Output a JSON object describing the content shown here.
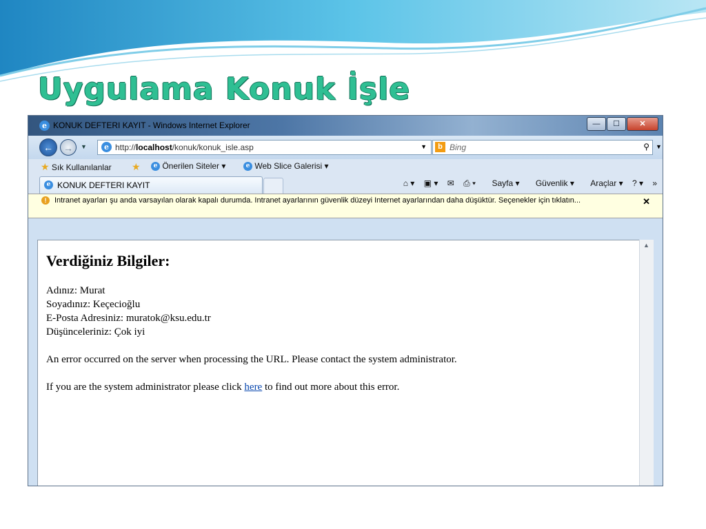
{
  "slide": {
    "title": "Uygulama Konuk İşle"
  },
  "window": {
    "title": "KONUK DEFTERI KAYIT - Windows Internet Explorer",
    "buttons": {
      "minimize": "—",
      "maximize": "☐",
      "close": "✕"
    }
  },
  "navbar": {
    "address_prefix": "http://",
    "address_host": "localhost",
    "address_path": "/konuk/konuk_isle.asp",
    "search_placeholder": "Bing"
  },
  "favorites": {
    "favorites_label": "Sık Kullanılanlar",
    "suggested_sites": "Önerilen Siteler",
    "web_slice": "Web Slice Galerisi"
  },
  "tabs": {
    "active_tab": "KONUK DEFTERI KAYIT"
  },
  "command_bar": {
    "page": "Sayfa",
    "safety": "Güvenlik",
    "tools": "Araçlar"
  },
  "infobar": {
    "text": "Intranet ayarları şu anda varsayılan olarak kapalı durumda. Intranet ayarlarının güvenlik düzeyi Internet ayarlarından daha düşüktür. Seçenekler için tıklatın..."
  },
  "content": {
    "heading": "Verdiğiniz Bilgiler:",
    "name_line": "Adınız: Murat",
    "surname_line": "Soyadınız: Keçecioğlu",
    "email_line": "E-Posta Adresiniz: muratok@ksu.edu.tr",
    "thoughts_line": "Düşünceleriniz: Çok iyi",
    "error_line": "An error occurred on the server when processing the URL. Please contact the system administrator.",
    "admin_before": "If you are the system administrator please click ",
    "admin_link": "here",
    "admin_after": " to find out more about this error."
  },
  "colors": {
    "slide_title": "#2fbf93",
    "wave": "#4fb3d9",
    "infobar_bg": "#ffffe1",
    "link": "#0645ad"
  }
}
